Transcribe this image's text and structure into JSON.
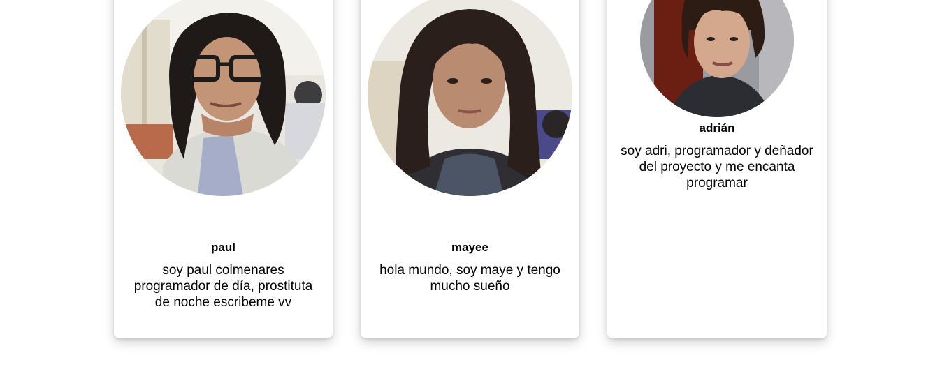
{
  "members": [
    {
      "name": "paul",
      "bio": "soy paul colmenares programador de día, prostituta de noche escribeme vv",
      "photo_alt": "photo of paul"
    },
    {
      "name": "mayee",
      "bio": "hola mundo, soy maye y tengo mucho sueño",
      "photo_alt": "photo of mayee"
    },
    {
      "name": "adrián",
      "bio": "soy adri, programador y deñador del proyecto y me encanta programar",
      "photo_alt": "photo of adrián"
    }
  ]
}
